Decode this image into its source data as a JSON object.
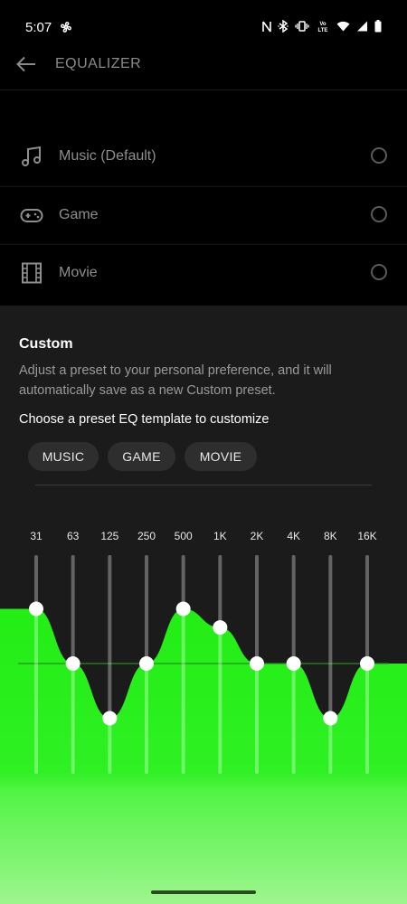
{
  "status_bar": {
    "time": "5:07",
    "icons": [
      "fan-icon",
      "nfc-icon",
      "bluetooth-icon",
      "vibrate-icon",
      "volte-icon",
      "wifi-icon",
      "signal-icon",
      "battery-icon"
    ],
    "volte_text": "VoLTE"
  },
  "header": {
    "title": "EQUALIZER"
  },
  "presets": [
    {
      "label": "Music (Default)",
      "icon": "music-note-icon"
    },
    {
      "label": "Game",
      "icon": "gamepad-icon"
    },
    {
      "label": "Movie",
      "icon": "film-icon"
    }
  ],
  "custom": {
    "title": "Custom",
    "description": "Adjust a preset to your personal preference, and it will automatically save as a new Custom preset.",
    "choose_label": "Choose a preset EQ template to customize",
    "chips": [
      "MUSIC",
      "GAME",
      "MOVIE"
    ]
  },
  "equalizer": {
    "bands": [
      "31",
      "63",
      "125",
      "250",
      "500",
      "1K",
      "2K",
      "4K",
      "8K",
      "16K"
    ],
    "levels": [
      0.5,
      0,
      -0.5,
      0,
      0.5,
      0.33,
      0,
      0,
      -0.5,
      0
    ],
    "curve_color": "#2ef023",
    "fill_bottom_color": "#9ef58f"
  },
  "colors": {
    "background": "#000000",
    "panel": "#1b1b1b",
    "accent": "#2ef023",
    "muted_text": "#8e8e8e"
  }
}
